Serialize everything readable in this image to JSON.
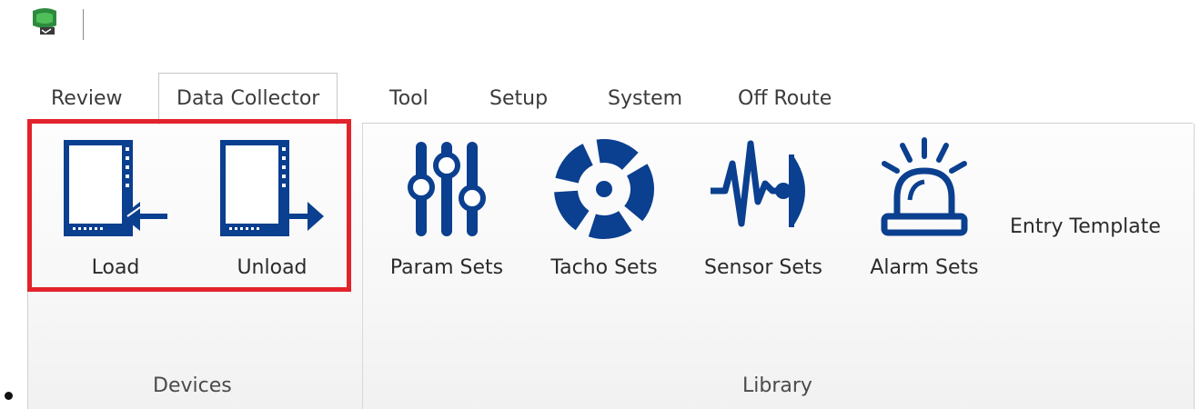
{
  "quick_access": {
    "app_icon": "app-logo-icon"
  },
  "tabs": [
    {
      "label": "Review",
      "active": false
    },
    {
      "label": "Data Collector",
      "active": true
    },
    {
      "label": "Tool",
      "active": false
    },
    {
      "label": "Setup",
      "active": false
    },
    {
      "label": "System",
      "active": false
    },
    {
      "label": "Off Route",
      "active": false
    }
  ],
  "ribbon": {
    "devices": {
      "group_label": "Devices",
      "load": {
        "label": "Load",
        "icon": "device-load-icon"
      },
      "unload": {
        "label": "Unload",
        "icon": "device-unload-icon"
      }
    },
    "library": {
      "group_label": "Library",
      "param_sets": {
        "label": "Param Sets",
        "icon": "sliders-icon"
      },
      "tacho_sets": {
        "label": "Tacho Sets",
        "icon": "tacho-icon"
      },
      "sensor_sets": {
        "label": "Sensor Sets",
        "icon": "sensor-icon"
      },
      "alarm_sets": {
        "label": "Alarm Sets",
        "icon": "alarm-icon"
      },
      "entry_template": {
        "label": "Entry Template"
      }
    }
  },
  "colors": {
    "icon_blue": "#0b3f8f",
    "highlight_red": "#e2232b",
    "app_green": "#2e8b3e"
  }
}
